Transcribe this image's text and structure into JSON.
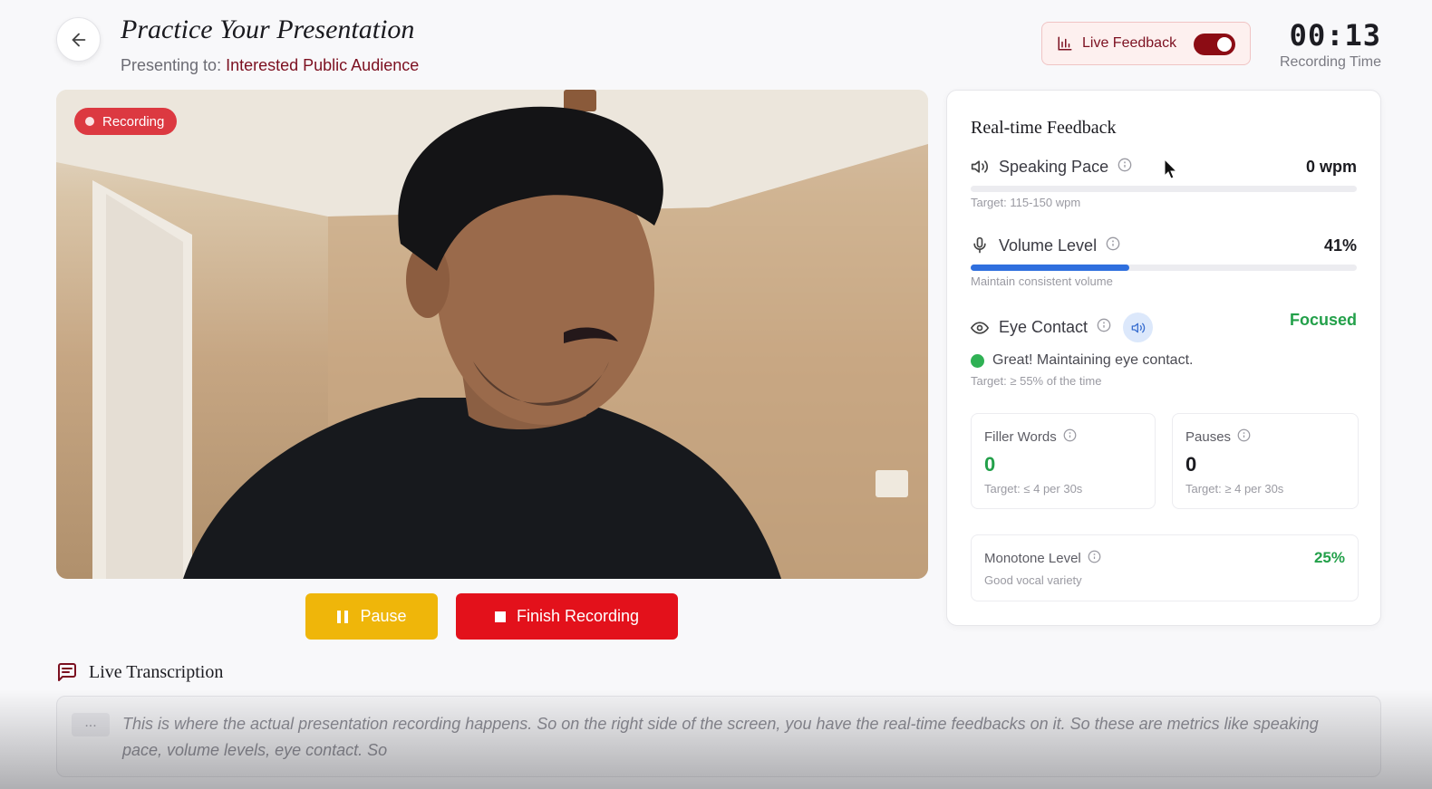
{
  "header": {
    "title": "Practice Your Presentation",
    "presenting_prefix": "Presenting to:",
    "audience": "Interested Public Audience",
    "back_icon": "arrow-left-icon"
  },
  "live_feedback": {
    "label": "Live Feedback",
    "enabled": true,
    "icon": "bar-chart-icon"
  },
  "timer": {
    "value": "00:13",
    "label": "Recording Time"
  },
  "video": {
    "recording_label": "Recording"
  },
  "controls": {
    "pause_label": "Pause",
    "finish_label": "Finish Recording"
  },
  "feedback": {
    "title": "Real-time Feedback",
    "speaking_pace": {
      "label": "Speaking Pace",
      "value": "0 wpm",
      "progress": 0,
      "hint": "Target: 115-150 wpm",
      "icon": "speaker-icon"
    },
    "volume": {
      "label": "Volume Level",
      "value": "41%",
      "progress": 0.41,
      "hint": "Maintain consistent volume",
      "icon": "microphone-icon"
    },
    "eye_contact": {
      "label": "Eye Contact",
      "value": "Focused",
      "status": "Great! Maintaining eye contact.",
      "hint": "Target: ≥ 55% of the time",
      "icon": "eye-icon"
    },
    "filler_words": {
      "label": "Filler Words",
      "value": "0",
      "hint": "Target: ≤ 4 per 30s"
    },
    "pauses": {
      "label": "Pauses",
      "value": "0",
      "hint": "Target: ≥ 4 per 30s"
    },
    "monotone": {
      "label": "Monotone Level",
      "value": "25%",
      "hint": "Good vocal variety"
    }
  },
  "transcription": {
    "title": "Live Transcription",
    "ellipsis": "...",
    "text": "This is where the actual presentation recording happens. So on the right side of the screen, you have the real-time feedbacks on it. So these are metrics like speaking pace, volume levels, eye contact. So"
  },
  "colors": {
    "brand": "#7c1020",
    "toggle": "#8c0c14",
    "pause": "#efb60a",
    "finish": "#e3111b",
    "volume_fill": "#2f6fde",
    "positive": "#23a04a"
  }
}
